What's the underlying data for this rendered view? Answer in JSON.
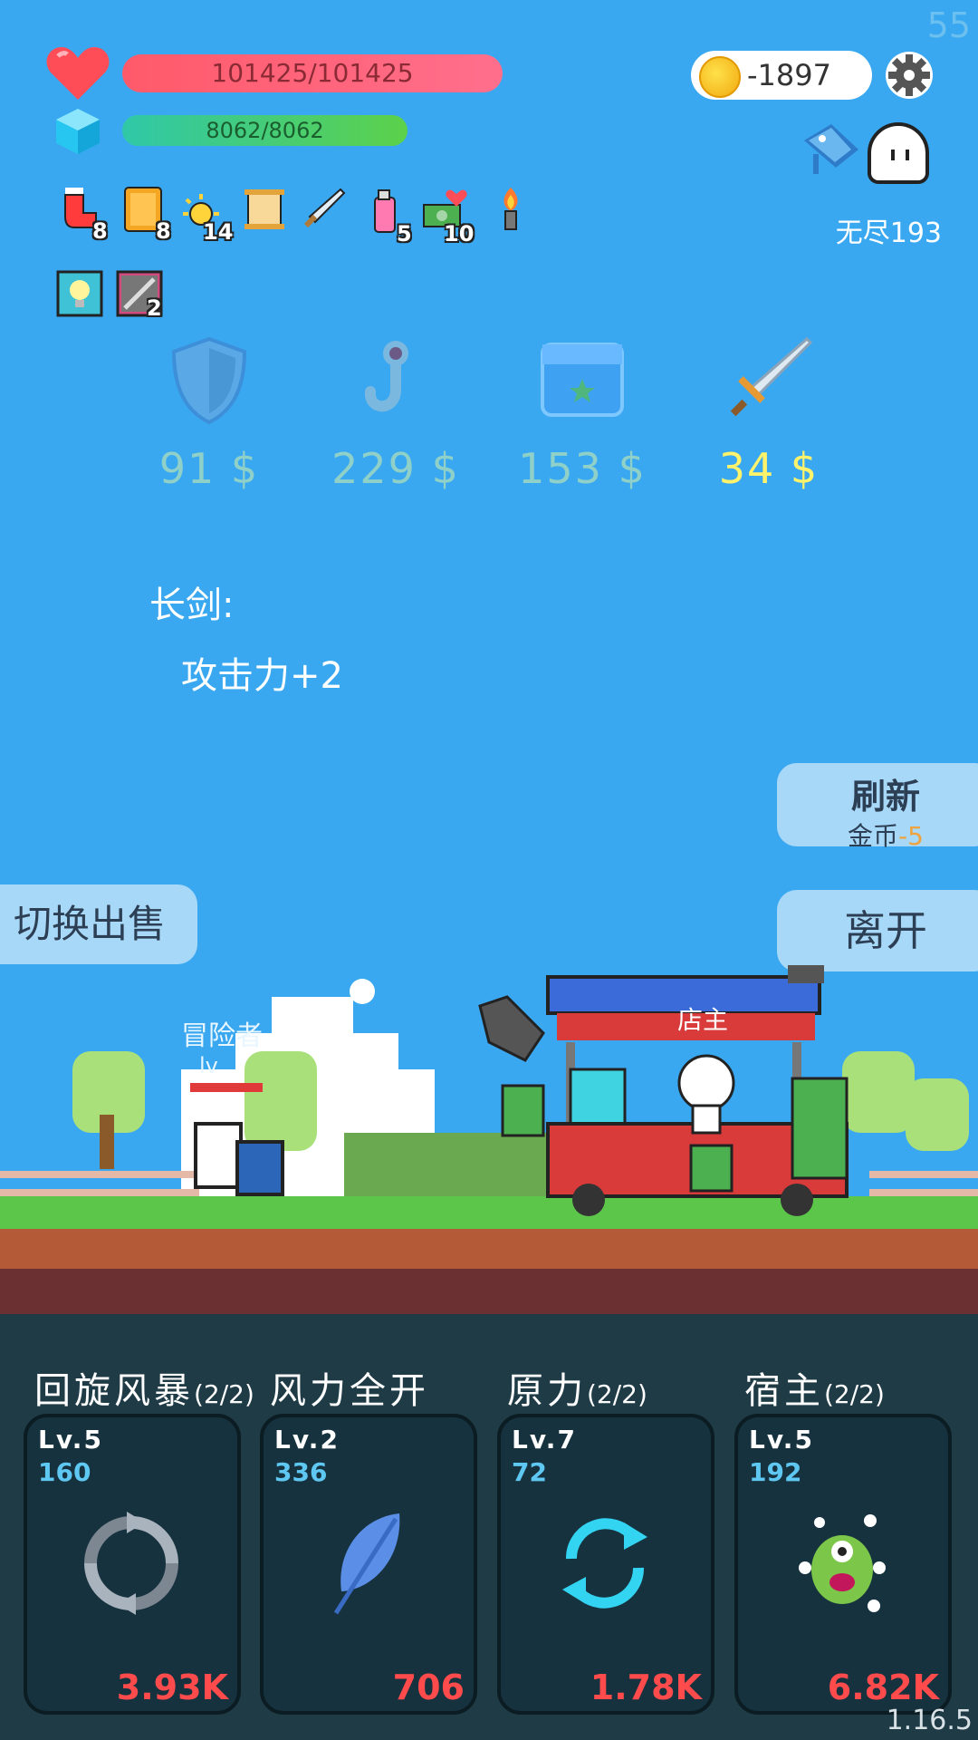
{
  "fps": "55",
  "hp": {
    "text": "101425/101425",
    "fraction": 1.0
  },
  "mp": {
    "text": "8062/8062",
    "fraction": 1.0
  },
  "coins": "-1897",
  "mode": "无尽193",
  "items": [
    {
      "icon": "sock-icon",
      "count": "8"
    },
    {
      "icon": "book-icon",
      "count": "8"
    },
    {
      "icon": "sun-icon",
      "count": "14"
    },
    {
      "icon": "scroll-icon",
      "count": ""
    },
    {
      "icon": "sword-icon",
      "count": ""
    },
    {
      "icon": "potion-icon",
      "count": "5"
    },
    {
      "icon": "money-heart-icon",
      "count": "10"
    },
    {
      "icon": "torch-icon",
      "count": ""
    }
  ],
  "items2": [
    {
      "icon": "lightbulb-card-icon",
      "count": ""
    },
    {
      "icon": "blade-card-icon",
      "count": "2"
    }
  ],
  "shop": [
    {
      "icon": "shield-icon",
      "price": "91 $"
    },
    {
      "icon": "hook-icon",
      "price": "229 $"
    },
    {
      "icon": "chest-icon",
      "price": "153 $"
    },
    {
      "icon": "longsword-icon",
      "price": "34 $"
    }
  ],
  "selected": {
    "title": "长剑:",
    "effect": "攻击力+2"
  },
  "buttons": {
    "refresh": "刷新",
    "refresh_cost_label": "金币",
    "refresh_cost_value": "-5",
    "leave": "离开",
    "switch_sell": "切换出售"
  },
  "scene": {
    "adventurer_label": "冒险者",
    "adventurer_level": "lv",
    "owner_label": "店主"
  },
  "skills": [
    {
      "name": "回旋风暴",
      "uses": "(2/2)",
      "level": "Lv.5",
      "cost": "160",
      "price": "3.93K",
      "icon": "whirlwind-icon"
    },
    {
      "name": "风力全开",
      "uses": "",
      "level": "Lv.2",
      "cost": "336",
      "price": "706",
      "icon": "feather-icon"
    },
    {
      "name": "原力",
      "uses": "(2/2)",
      "level": "Lv.7",
      "cost": "72",
      "price": "1.78K",
      "icon": "cycle-icon"
    },
    {
      "name": "宿主",
      "uses": "(2/2)",
      "level": "Lv.5",
      "cost": "192",
      "price": "6.82K",
      "icon": "monster-icon"
    }
  ],
  "version": "1.16.5"
}
